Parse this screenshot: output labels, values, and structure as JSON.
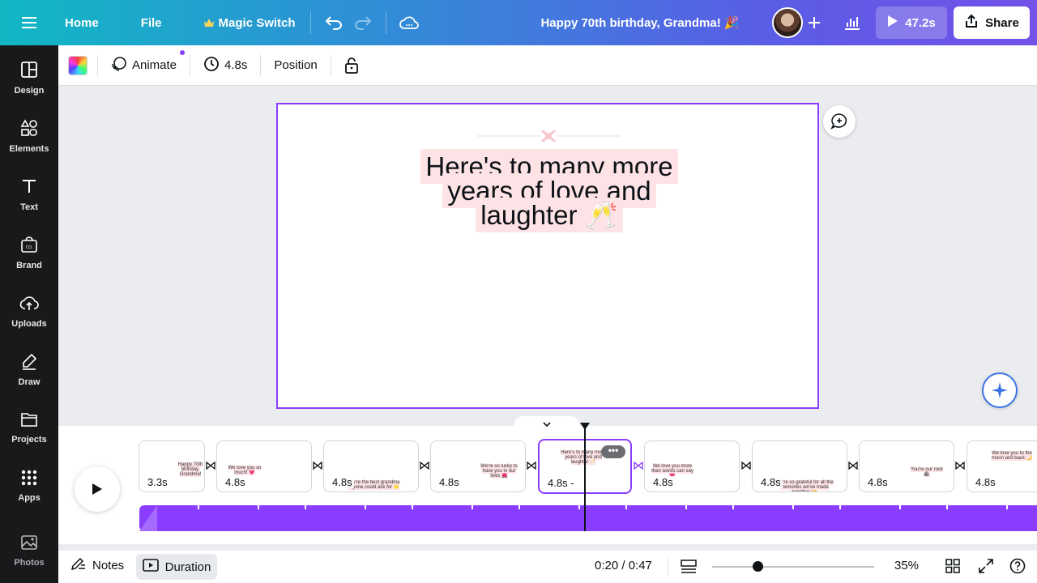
{
  "topbar": {
    "home_label": "Home",
    "file_label": "File",
    "magic_switch_label": "Magic Switch",
    "doc_title": "Happy 70th birthday, Grandma! 🎉",
    "play_duration": "47.2s",
    "share_label": "Share",
    "gradient_start": "#11b7c4",
    "gradient_end": "#7352e8"
  },
  "sidebar": {
    "items": [
      {
        "label": "Design",
        "icon": "design-icon"
      },
      {
        "label": "Elements",
        "icon": "elements-icon"
      },
      {
        "label": "Text",
        "icon": "text-icon"
      },
      {
        "label": "Brand",
        "icon": "brand-icon"
      },
      {
        "label": "Uploads",
        "icon": "uploads-icon"
      },
      {
        "label": "Draw",
        "icon": "draw-icon"
      },
      {
        "label": "Projects",
        "icon": "projects-icon"
      },
      {
        "label": "Apps",
        "icon": "apps-icon"
      },
      {
        "label": "Photos",
        "icon": "photos-icon"
      }
    ]
  },
  "context_toolbar": {
    "animate_label": "Animate",
    "duration_label": "4.8s",
    "position_label": "Position"
  },
  "slide": {
    "text_lines": [
      "Here's to many more",
      "years of love and",
      "laughter 🥂"
    ]
  },
  "timeline": {
    "clips": [
      {
        "duration": "3.3s",
        "mini": "Happy 70th birthday, Grandma!"
      },
      {
        "duration": "4.8s",
        "mini": "We love you so much! 💗"
      },
      {
        "duration": "4.8s",
        "mini": "You're the best grandma anyone could ask for 🌟"
      },
      {
        "duration": "4.8s",
        "mini": "We're so lucky to have you in our lives 🌺"
      },
      {
        "duration": "4.8s -",
        "mini": "Here's to many more years of love and laughter 🥂"
      },
      {
        "duration": "4.8s",
        "mini": "We love you more than words can say 💗"
      },
      {
        "duration": "4.8s",
        "mini": "We're so grateful for all the memories we've made together 🙌"
      },
      {
        "duration": "4.8s",
        "mini": "You're our rock 🪨"
      },
      {
        "duration": "4.8s",
        "mini": "We love you to the moon and back 🌙"
      }
    ],
    "more_label": "•••"
  },
  "bottombar": {
    "notes_label": "Notes",
    "duration_label": "Duration",
    "time_display": "0:20 / 0:47",
    "zoom_label": "35%",
    "zoom_value": 0.28
  },
  "colors": {
    "accent": "#8b3dff",
    "highlight": "#fde3e6",
    "sidebar_bg": "#18191b"
  }
}
